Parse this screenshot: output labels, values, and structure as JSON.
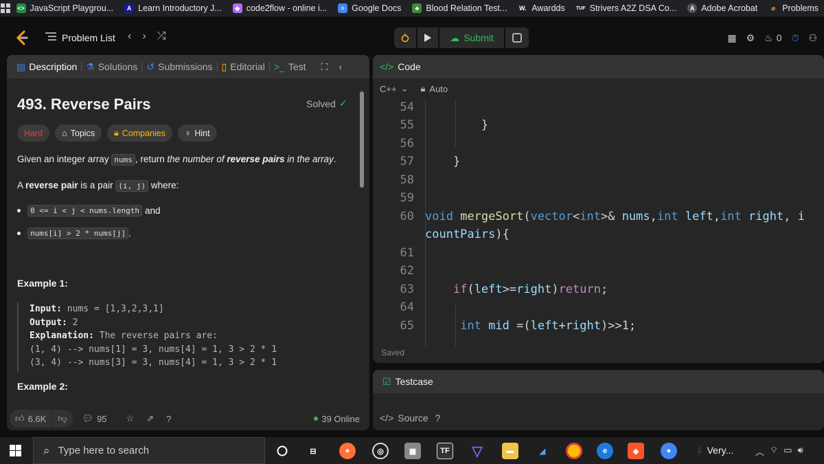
{
  "bookmarks": [
    {
      "label": "JavaScript Playgrou...",
      "icon": "code-icon",
      "color": "#1e8e3e"
    },
    {
      "label": "Learn Introductory J...",
      "icon": "learn-icon",
      "color": "#1a1a8c"
    },
    {
      "label": "code2flow - online i...",
      "icon": "code2flow-icon",
      "color": "#b16cf2"
    },
    {
      "label": "Google Docs",
      "icon": "docs-icon",
      "color": "#4285f4"
    },
    {
      "label": "Blood Relation Test...",
      "icon": "tree-icon",
      "color": "#3a8c3a"
    },
    {
      "label": "Awardds",
      "icon": "w-icon",
      "color": "#202124"
    },
    {
      "label": "Strivers A2Z DSA Co...",
      "icon": "tuf-icon",
      "color": "#202124"
    },
    {
      "label": "Adobe Acrobat",
      "icon": "acrobat-icon",
      "color": "#555"
    },
    {
      "label": "Problems",
      "icon": "leetcode-icon",
      "color": "#f89f1b"
    }
  ],
  "nav": {
    "problem_list": "Problem List",
    "submit": "Submit",
    "streak_count": "0"
  },
  "tabs": {
    "description": "Description",
    "solutions": "Solutions",
    "submissions": "Submissions",
    "editorial": "Editorial",
    "test": "Test"
  },
  "problem": {
    "title": "493. Reverse Pairs",
    "status": "Solved",
    "difficulty": "Hard",
    "chips": {
      "topics": "Topics",
      "companies": "Companies",
      "hint": "Hint"
    },
    "desc1_a": "Given an integer array ",
    "desc1_code": "nums",
    "desc1_b": ", return ",
    "desc1_c": "the number of ",
    "desc1_d": "reverse pairs",
    "desc1_e": " in the array",
    "desc1_f": ".",
    "desc2_a": "A ",
    "desc2_b": "reverse pair",
    "desc2_c": " is a pair ",
    "desc2_code": "(i, j)",
    "desc2_d": " where:",
    "bullet1_code": "0 <= i < j < nums.length",
    "bullet1_text": "and",
    "bullet2_code": "nums[i] > 2 * nums[j]",
    "bullet2_text": ".",
    "example1": "Example 1:",
    "ex_input_label": "Input:",
    "ex_input": " nums = [1,3,2,3,1]",
    "ex_output_label": "Output:",
    "ex_output": " 2",
    "ex_expl_label": "Explanation:",
    "ex_expl": " The reverse pairs are:",
    "ex_line4": "(1, 4) --> nums[1] = 3, nums[4] = 1, 3 > 2 * 1",
    "ex_line5": "(3, 4) --> nums[3] = 3, nums[4] = 1, 3 > 2 * 1",
    "example2": "Example 2:"
  },
  "footer": {
    "likes": "6.6K",
    "comments": "95",
    "online": "39 Online"
  },
  "editor": {
    "title": "Code",
    "language": "C++",
    "mode": "Auto",
    "saved": "Saved",
    "lines": [
      {
        "n": "54",
        "code": ""
      },
      {
        "n": "55",
        "code": "        }"
      },
      {
        "n": "56",
        "code": ""
      },
      {
        "n": "57",
        "code": "    }"
      },
      {
        "n": "58",
        "code": ""
      },
      {
        "n": "59",
        "code": ""
      },
      {
        "n": "60",
        "code": "void mergeSort(vector<int>& nums,int left,int right, i"
      },
      {
        "n": "",
        "code": "countPairs){"
      },
      {
        "n": "61",
        "code": ""
      },
      {
        "n": "62",
        "code": ""
      },
      {
        "n": "63",
        "code": "    if(left>=right)return;"
      },
      {
        "n": "64",
        "code": ""
      },
      {
        "n": "65",
        "code": "     int mid =(left+right)>>1;"
      }
    ]
  },
  "testcase": {
    "title": "Testcase",
    "source": "Source"
  },
  "taskbar": {
    "search_placeholder": "Type here to search",
    "very": "Very..."
  }
}
